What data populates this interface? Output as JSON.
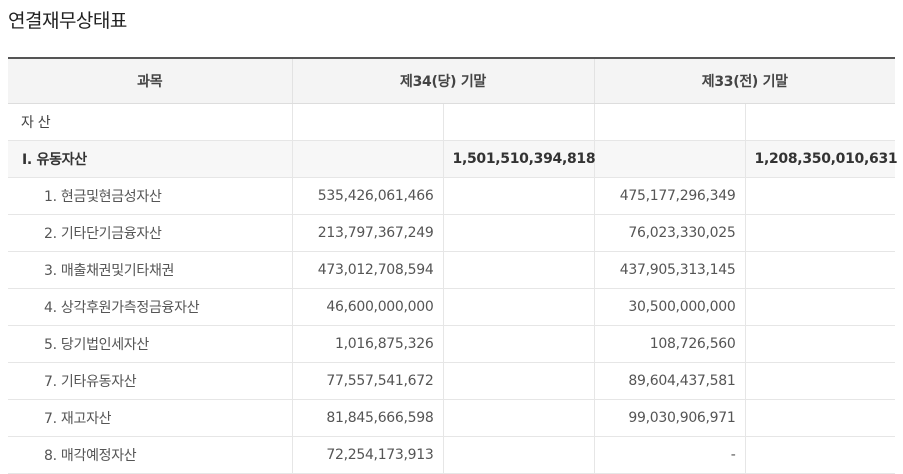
{
  "title": "연결재무상태표",
  "table": {
    "header": {
      "account": "과목",
      "current_period": "제34(당) 기말",
      "prior_period": "제33(전) 기말"
    },
    "rows": [
      {
        "type": "section",
        "label": "자 산",
        "cur_detail": "",
        "cur_total": "",
        "prev_detail": "",
        "prev_total": ""
      },
      {
        "type": "group",
        "label": "Ⅰ. 유동자산",
        "cur_detail": "",
        "cur_total": "1,501,510,394,818",
        "prev_detail": "",
        "prev_total": "1,208,350,010,631"
      },
      {
        "type": "item",
        "label": "1. 현금및현금성자산",
        "cur_detail": "535,426,061,466",
        "cur_total": "",
        "prev_detail": "475,177,296,349",
        "prev_total": ""
      },
      {
        "type": "item",
        "label": "2. 기타단기금융자산",
        "cur_detail": "213,797,367,249",
        "cur_total": "",
        "prev_detail": "76,023,330,025",
        "prev_total": ""
      },
      {
        "type": "item",
        "label": "3. 매출채권및기타채권",
        "cur_detail": "473,012,708,594",
        "cur_total": "",
        "prev_detail": "437,905,313,145",
        "prev_total": ""
      },
      {
        "type": "item",
        "label": "4. 상각후원가측정금융자산",
        "cur_detail": "46,600,000,000",
        "cur_total": "",
        "prev_detail": "30,500,000,000",
        "prev_total": ""
      },
      {
        "type": "item",
        "label": "5. 당기법인세자산",
        "cur_detail": "1,016,875,326",
        "cur_total": "",
        "prev_detail": "108,726,560",
        "prev_total": ""
      },
      {
        "type": "item",
        "label": "7. 기타유동자산",
        "cur_detail": "77,557,541,672",
        "cur_total": "",
        "prev_detail": "89,604,437,581",
        "prev_total": ""
      },
      {
        "type": "item",
        "label": "7. 재고자산",
        "cur_detail": "81,845,666,598",
        "cur_total": "",
        "prev_detail": "99,030,906,971",
        "prev_total": ""
      },
      {
        "type": "item",
        "label": "8. 매각예정자산",
        "cur_detail": "72,254,173,913",
        "cur_total": "",
        "prev_detail": "-",
        "prev_total": ""
      }
    ]
  }
}
